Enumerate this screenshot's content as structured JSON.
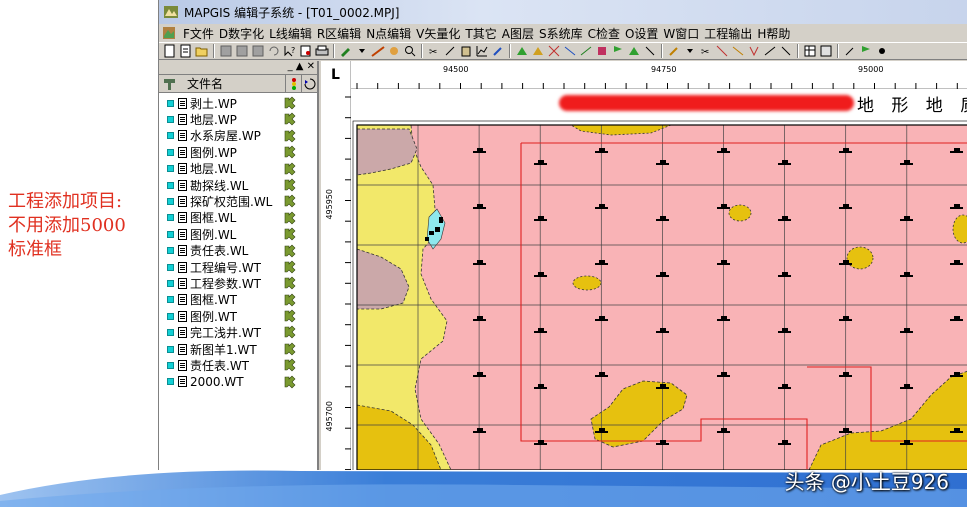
{
  "annotation": {
    "lines": [
      "工程添加项目:",
      "不用添加5000",
      "标准框"
    ]
  },
  "window": {
    "title": "MAPGIS 编辑子系统 - [T01_0002.MPJ]"
  },
  "menu": {
    "items": [
      "F文件",
      "D数字化",
      "L线编辑",
      "R区编辑",
      "N点编辑",
      "V矢量化",
      "T其它",
      "A图层",
      "S系统库",
      "C检查",
      "O设置",
      "W窗口",
      "工程输出",
      "H帮助"
    ]
  },
  "panel": {
    "header_label": "文件名",
    "controls": "_ ▲ ✕",
    "files": [
      "剥土.WP",
      "地层.WP",
      "水系房屋.WP",
      "图例.WP",
      "地层.WL",
      "勘探线.WL",
      "探矿权范围.WL",
      "图框.WL",
      "图例.WL",
      "责任表.WL",
      "工程编号.WT",
      "工程参数.WT",
      "图框.WT",
      "图例.WT",
      "完工浅井.WT",
      "新图羊1.WT",
      "责任表.WT",
      "2000.WT"
    ]
  },
  "rulers": {
    "h_labels": [
      "94500",
      "94750",
      "95000"
    ],
    "v_labels": [
      "495950",
      "495700"
    ],
    "corner_symbol": "L"
  },
  "map": {
    "title": "地 形 地 质",
    "colors": {
      "pink": "#f9b3b6",
      "yellow": "#f2e86a",
      "olive": "#e6c10f",
      "mauve": "#cba8a9",
      "cyan": "#8ee8ee",
      "redline": "#e02020"
    }
  },
  "footer": {
    "watermark": "头条 @小土豆926",
    "swoosh_color": "#2f6fd1"
  }
}
